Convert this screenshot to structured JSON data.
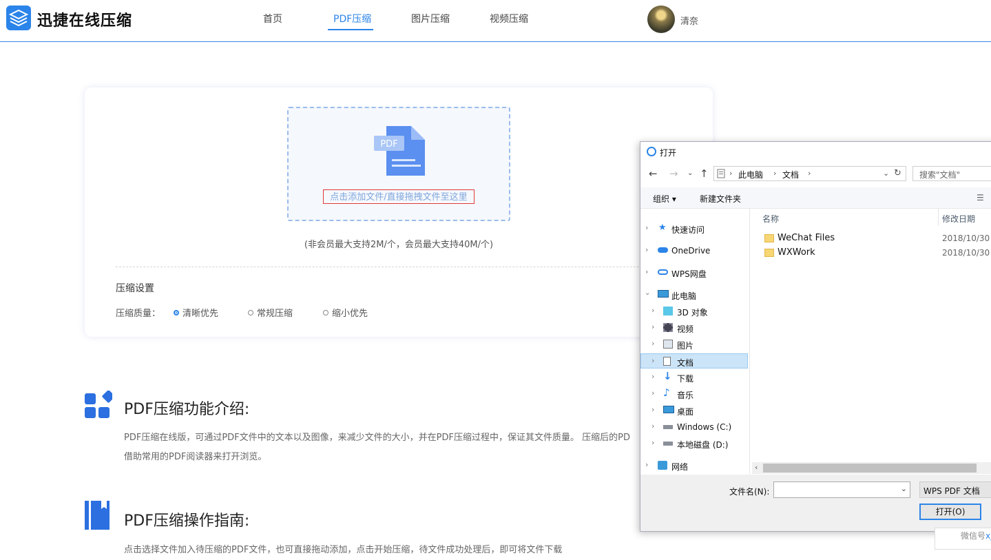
{
  "header": {
    "logo_text": "迅捷在线压缩",
    "nav": [
      "首页",
      "PDF压缩",
      "图片压缩",
      "视频压缩"
    ],
    "active_nav": "PDF压缩",
    "username": "清奈"
  },
  "upload": {
    "file_badge": "PDF",
    "drop_text": "点击添加文件/直接拖拽文件至这里",
    "limit_text": "(非会员最大支持2M/个，会员最大支持40M/个)",
    "settings_title": "压缩设置",
    "quality_label": "压缩质量：",
    "quality_options": [
      "清晰优先",
      "常规压缩",
      "缩小优先"
    ],
    "quality_selected": "清晰优先"
  },
  "sections": [
    {
      "title": "PDF压缩功能介绍:",
      "text_line1": "PDF压缩在线版，可通过PDF文件中的文本以及图像，来减少文件的大小，并在PDF压缩过程中，保证其文件质量。 压缩后的PD",
      "text_line2": "借助常用的PDF阅读器来打开浏览。"
    },
    {
      "title": "PDF压缩操作指南:",
      "text_line1": "点击选择文件加入待压缩的PDF文件，也可直接拖动添加，点击开始压缩，待文件成功处理后，即可将文件下载"
    }
  ],
  "dialog": {
    "title": "打开",
    "breadcrumb": [
      "此电脑",
      "文档"
    ],
    "search_placeholder": "搜索\"文档\"",
    "toolbar": {
      "organize": "组织",
      "new_folder": "新建文件夹"
    },
    "tree": {
      "quick_access": "快速访问",
      "onedrive": "OneDrive",
      "wps": "WPS网盘",
      "this_pc": "此电脑",
      "obj3d": "3D 对象",
      "videos": "视频",
      "pictures": "图片",
      "documents": "文档",
      "downloads": "下载",
      "music": "音乐",
      "desktop": "桌面",
      "drive_c": "Windows (C:)",
      "drive_d": "本地磁盘 (D:)",
      "network": "网络"
    },
    "columns": {
      "name": "名称",
      "modified": "修改日期"
    },
    "files": [
      {
        "name": "WeChat Files",
        "date": "2018/10/30"
      },
      {
        "name": "WXWork",
        "date": "2018/10/30"
      }
    ],
    "filename_label": "文件名(N):",
    "filename_value": "",
    "file_type": "WPS PDF 文档",
    "open_button": "打开(O)"
  },
  "overlay": {
    "weixin_label": "微信号",
    "weixin_value": "xj"
  },
  "colors": {
    "accent": "#2b84e9",
    "annotation_arrow": "#e53030"
  }
}
